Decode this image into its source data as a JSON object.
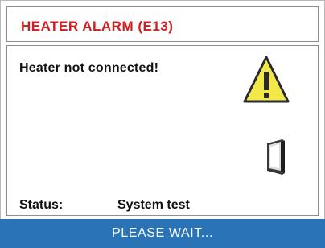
{
  "alarm": {
    "title": "HEATER ALARM (E13)",
    "message": "Heater not connected!",
    "status_label": "Status:",
    "status_value": "System test",
    "footer_text": "PLEASE WAIT..."
  },
  "icons": {
    "warning": "warning-triangle-icon",
    "device": "heater-device-icon"
  },
  "colors": {
    "title": "#d21e1e",
    "footer_bar": "#2b73b7",
    "warning_fill": "#f3e84a"
  }
}
